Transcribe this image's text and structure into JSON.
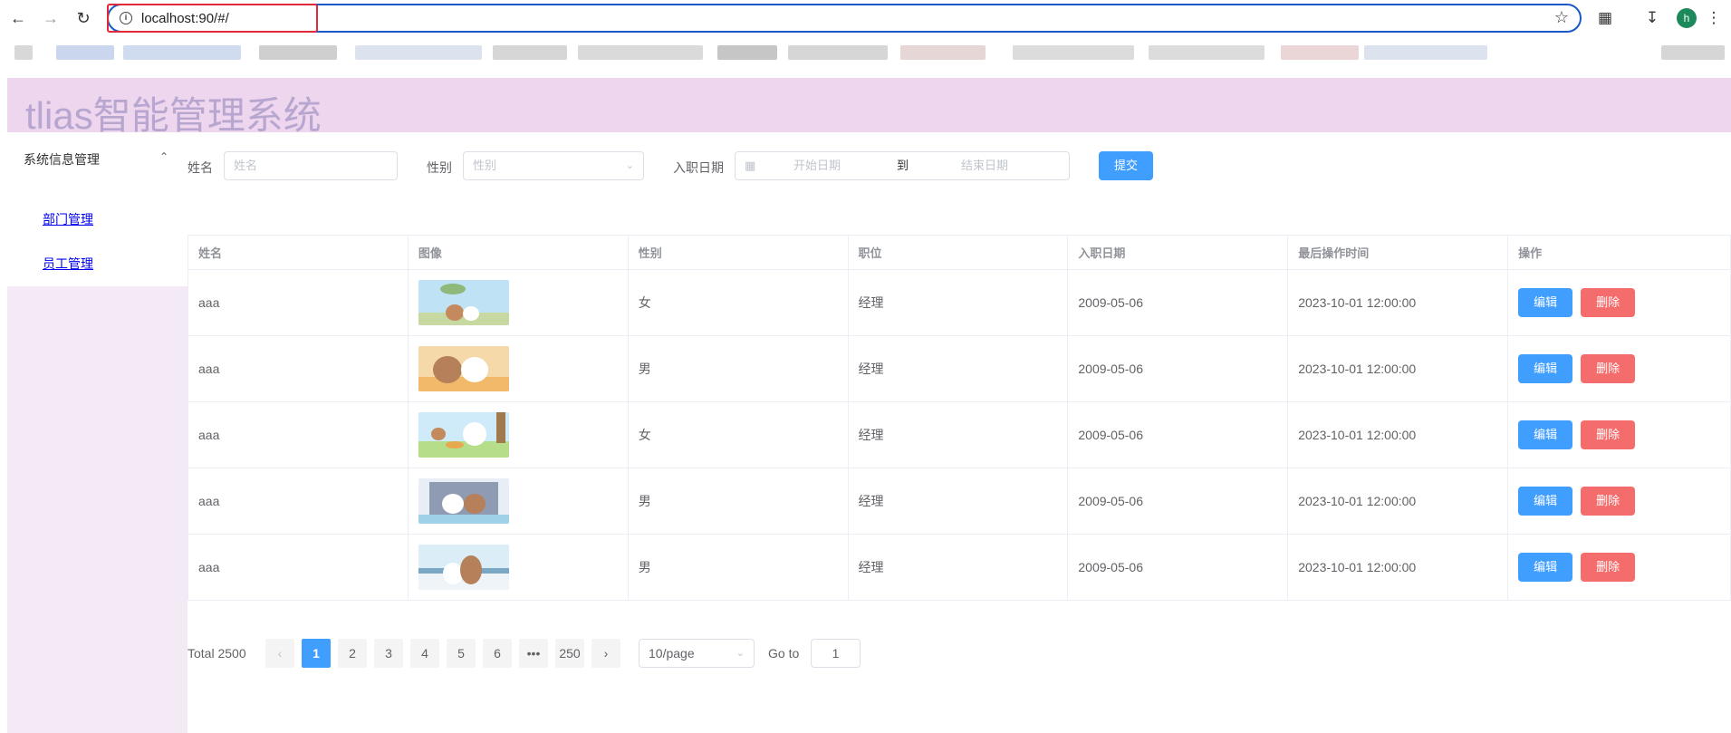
{
  "browser": {
    "url": "localhost:90/#/",
    "avatar_letter": "h"
  },
  "app": {
    "title": "tlias智能管理系统"
  },
  "sidebar": {
    "group_label": "系统信息管理",
    "items": [
      {
        "label": "部门管理"
      },
      {
        "label": "员工管理"
      }
    ]
  },
  "search": {
    "name_label": "姓名",
    "name_placeholder": "姓名",
    "gender_label": "性别",
    "gender_placeholder": "性别",
    "date_label": "入职日期",
    "date_start_placeholder": "开始日期",
    "date_separator": "到",
    "date_end_placeholder": "结束日期",
    "submit_label": "提交"
  },
  "table": {
    "columns": [
      "姓名",
      "图像",
      "性别",
      "职位",
      "入职日期",
      "最后操作时间",
      "操作"
    ],
    "edit_label": "编辑",
    "delete_label": "删除",
    "rows": [
      {
        "name": "aaa",
        "gender": "女",
        "job": "经理",
        "entry_date": "2009-05-06",
        "update_time": "2023-10-01 12:00:00"
      },
      {
        "name": "aaa",
        "gender": "男",
        "job": "经理",
        "entry_date": "2009-05-06",
        "update_time": "2023-10-01 12:00:00"
      },
      {
        "name": "aaa",
        "gender": "女",
        "job": "经理",
        "entry_date": "2009-05-06",
        "update_time": "2023-10-01 12:00:00"
      },
      {
        "name": "aaa",
        "gender": "男",
        "job": "经理",
        "entry_date": "2009-05-06",
        "update_time": "2023-10-01 12:00:00"
      },
      {
        "name": "aaa",
        "gender": "男",
        "job": "经理",
        "entry_date": "2009-05-06",
        "update_time": "2023-10-01 12:00:00"
      }
    ]
  },
  "pagination": {
    "total_text": "Total 2500",
    "pages": [
      "1",
      "2",
      "3",
      "4",
      "5",
      "6",
      "•••",
      "250"
    ],
    "current": "1",
    "page_size": "10/page",
    "goto_label": "Go to",
    "goto_value": "1"
  },
  "colors": {
    "primary": "#409eff",
    "danger": "#f56c6c",
    "header_bg": "#efd6ef",
    "title_text": "#b7a6cf",
    "aside_bg": "#f3eaf6"
  }
}
